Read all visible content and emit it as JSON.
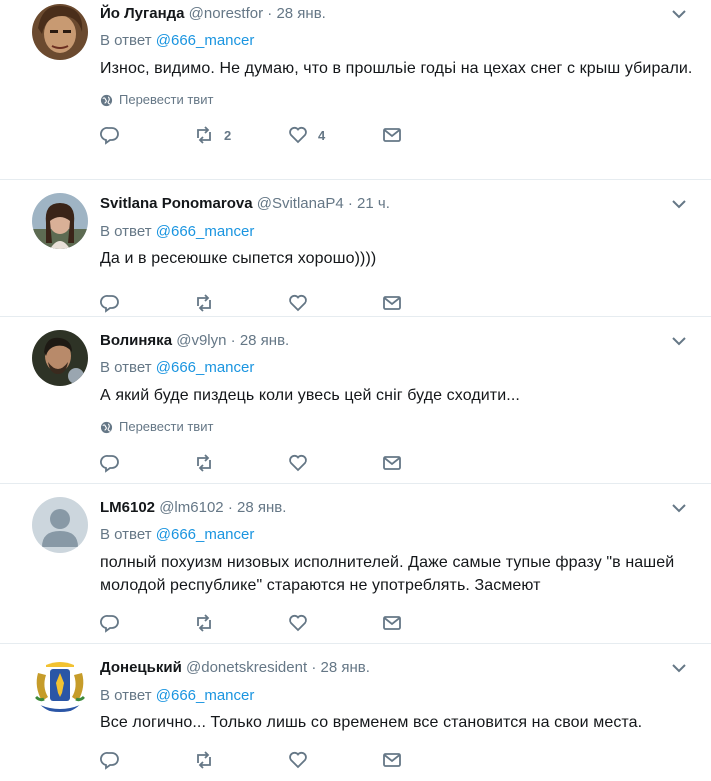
{
  "tweets": [
    {
      "name": "Йо Луганда",
      "handle": "@norestfor",
      "dot": "·",
      "time": "28 янв.",
      "reply_prefix": "В ответ",
      "reply_to": "@666_mancer",
      "text": "Износ, видимо. Не думаю, что в прошльіе годьі на цехах снег с крыш убирали.",
      "translate": "Перевести твит",
      "retweets": "2",
      "likes": "4"
    },
    {
      "name": "Svitlana Ponomarova",
      "handle": "@SvitlanaP4",
      "dot": "·",
      "time": "21 ч.",
      "reply_prefix": "В ответ",
      "reply_to": "@666_mancer",
      "text": "Да и в ресеюшке сыпется хорошо))))",
      "retweets": "",
      "likes": ""
    },
    {
      "name": "Волиняка",
      "handle": "@v9lyn",
      "dot": "·",
      "time": "28 янв.",
      "reply_prefix": "В ответ",
      "reply_to": "@666_mancer",
      "text": "А який буде пиздець коли увесь цей сніг буде сходити...",
      "translate": "Перевести твит",
      "retweets": "",
      "likes": ""
    },
    {
      "name": "LM6102",
      "handle": "@lm6102",
      "dot": "·",
      "time": "28 янв.",
      "reply_prefix": "В ответ",
      "reply_to": "@666_mancer",
      "text": "полный похуизм низовых исполнителей. Даже самые тупые фразу \"в нашей молодой республике\" стараются не употреблять. Засмеют",
      "retweets": "",
      "likes": ""
    },
    {
      "name": "Донецький",
      "handle": "@donetskresident",
      "dot": "·",
      "time": "28 янв.",
      "reply_prefix": "В ответ",
      "reply_to": "@666_mancer",
      "text": "Все логично... Только лишь со временем все становится на свои места.",
      "retweets": "",
      "likes": ""
    }
  ],
  "icons": {
    "reply": "reply-icon",
    "retweet": "retweet-icon",
    "like": "heart-icon",
    "dm": "envelope-icon",
    "caret": "chevron-down-icon",
    "globe": "globe-icon"
  },
  "colors": {
    "link": "#1b95e0",
    "muted": "#657786",
    "text": "#14171a",
    "border": "#e6ecf0"
  }
}
